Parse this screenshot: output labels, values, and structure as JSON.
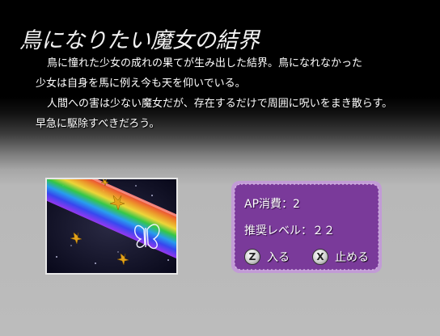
{
  "title": "鳥になりたい魔女の結界",
  "description": [
    "鳥に憧れた少女の成れの果てが生み出した結界。鳥になれなかった",
    "少女は自身を馬に例え今も天を仰いでいる。",
    "人間への害は少ない魔女だが、存在するだけで周囲に呪いをまき散らす。",
    "早急に駆除すべきだろう。"
  ],
  "info": {
    "ap_label": "AP消費：",
    "ap_value": "2",
    "level_label": "推奨レベル：",
    "level_value": "２２"
  },
  "buttons": {
    "enter": {
      "key": "Z",
      "label": "入る"
    },
    "stop": {
      "key": "X",
      "label": "止める"
    }
  },
  "colors": {
    "panel": "#7a3a9a",
    "panel_border": "#c29bd6",
    "title": "#f2f2f2"
  },
  "icons": {
    "enter_key": "z-key-icon",
    "stop_key": "x-key-icon"
  }
}
